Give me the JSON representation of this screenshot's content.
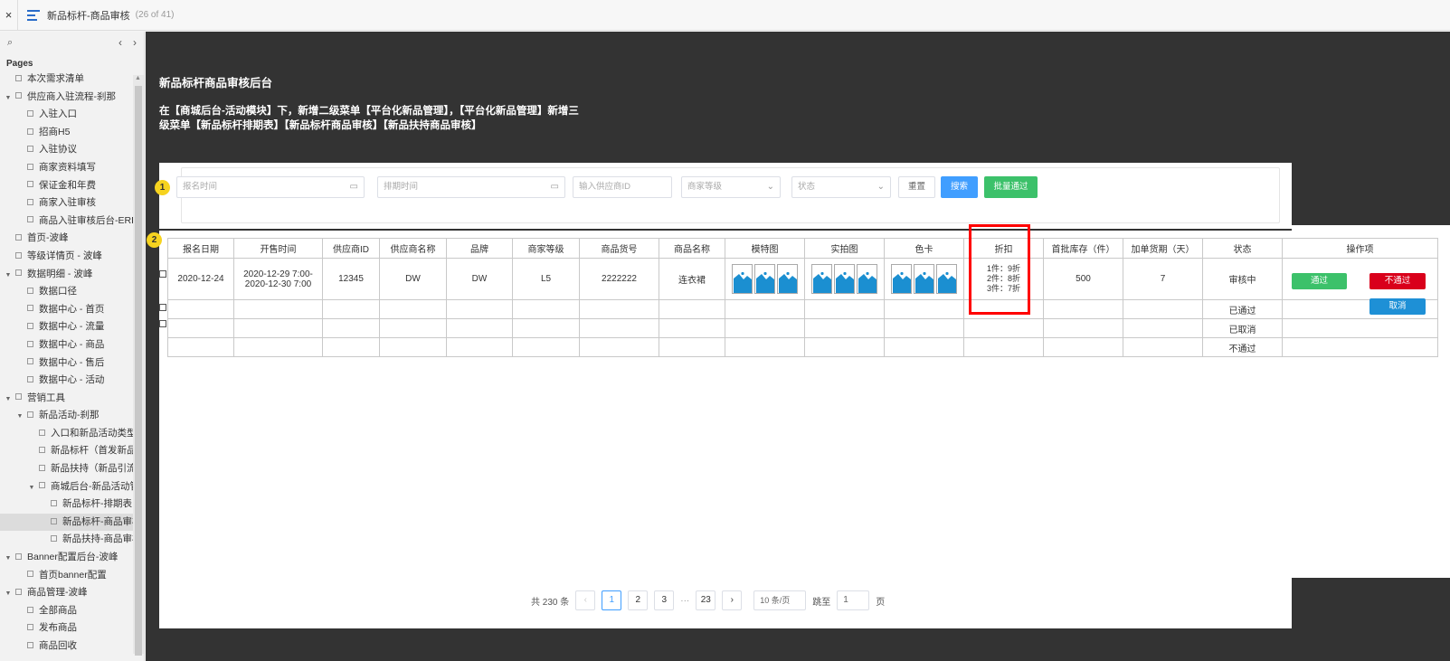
{
  "topbar": {
    "close": "×",
    "title": "新品标杆-商品审核",
    "count": "(26 of 41)"
  },
  "sidebar": {
    "search_icon": "⌕",
    "prev": "‹",
    "next": "›",
    "pages_label": "Pages",
    "items": [
      {
        "label": "本次需求清单",
        "level": 1,
        "toggle": ""
      },
      {
        "label": "供应商入驻流程-刹那",
        "level": 1,
        "toggle": "▼"
      },
      {
        "label": "入驻入口",
        "level": 2,
        "toggle": ""
      },
      {
        "label": "招商H5",
        "level": 2,
        "toggle": ""
      },
      {
        "label": "入驻协议",
        "level": 2,
        "toggle": ""
      },
      {
        "label": "商家资料填写",
        "level": 2,
        "toggle": ""
      },
      {
        "label": "保证金和年费",
        "level": 2,
        "toggle": ""
      },
      {
        "label": "商家入驻审核",
        "level": 2,
        "toggle": ""
      },
      {
        "label": "商品入驻审核后台-ERP",
        "level": 2,
        "toggle": ""
      },
      {
        "label": "首页-波峰",
        "level": 1,
        "toggle": ""
      },
      {
        "label": "等级详情页 - 波峰",
        "level": 1,
        "toggle": ""
      },
      {
        "label": "数据明细 - 波峰",
        "level": 1,
        "toggle": "▼"
      },
      {
        "label": "数据口径",
        "level": 2,
        "toggle": ""
      },
      {
        "label": "数据中心 - 首页",
        "level": 2,
        "toggle": ""
      },
      {
        "label": "数据中心 - 流量",
        "level": 2,
        "toggle": ""
      },
      {
        "label": "数据中心 - 商品",
        "level": 2,
        "toggle": ""
      },
      {
        "label": "数据中心 - 售后",
        "level": 2,
        "toggle": ""
      },
      {
        "label": "数据中心 - 活动",
        "level": 2,
        "toggle": ""
      },
      {
        "label": "营销工具",
        "level": 1,
        "toggle": "▼"
      },
      {
        "label": "新品活动-刹那",
        "level": 2,
        "toggle": "▼"
      },
      {
        "label": "入口和新品活动类型",
        "level": 3,
        "toggle": ""
      },
      {
        "label": "新品标杆（首发新品）",
        "level": 3,
        "toggle": ""
      },
      {
        "label": "新品扶持（新品引流）",
        "level": 3,
        "toggle": ""
      },
      {
        "label": "商城后台-新品活动管理",
        "level": 3,
        "toggle": "▼"
      },
      {
        "label": "新品标杆-排期表",
        "level": 4,
        "toggle": ""
      },
      {
        "label": "新品标杆-商品审核",
        "level": 4,
        "toggle": "",
        "selected": true
      },
      {
        "label": "新品扶持-商品审核",
        "level": 4,
        "toggle": ""
      },
      {
        "label": "Banner配置后台-波峰",
        "level": 1,
        "toggle": "▼"
      },
      {
        "label": "首页banner配置",
        "level": 2,
        "toggle": ""
      },
      {
        "label": "商品管理-波峰",
        "level": 1,
        "toggle": "▼"
      },
      {
        "label": "全部商品",
        "level": 2,
        "toggle": ""
      },
      {
        "label": "发布商品",
        "level": 2,
        "toggle": ""
      },
      {
        "label": "商品回收",
        "level": 2,
        "toggle": ""
      }
    ]
  },
  "page": {
    "heading": "新品标杆商品审核后台",
    "desc_line1": "在【商城后台-活动模块】下，新增二级菜单【平台化新品管理】，【平台化新品管理】新增三",
    "desc_line2": "级菜单【新品标杆排期表】【新品标杆商品审核】【新品扶持商品审核】"
  },
  "badges": {
    "one": "1",
    "two": "2"
  },
  "filters": {
    "signup_time": "报名时间",
    "schedule_time": "排期时间",
    "supplier_id": "输入供应商ID",
    "merchant_level": "商家等级",
    "status": "状态",
    "reset": "重置",
    "search": "搜索",
    "batch_pass": "批量通过"
  },
  "table": {
    "headers": [
      "报名日期",
      "开售时间",
      "供应商ID",
      "供应商名称",
      "品牌",
      "商家等级",
      "商品货号",
      "商品名称",
      "模特图",
      "实拍图",
      "色卡",
      "折扣",
      "首批库存（件）",
      "加单货期（天）",
      "状态",
      "操作项"
    ],
    "row1": {
      "date": "2020-12-24",
      "sale_start": "2020-12-29 7:00-",
      "sale_end": "2020-12-30 7:00",
      "supplier_id": "12345",
      "supplier_name": "DW",
      "brand": "DW",
      "level": "L5",
      "sku": "2222222",
      "name": "连衣裙",
      "discount1": "1件：9折",
      "discount2": "2件：8折",
      "discount3": "3件：7折",
      "stock": "500",
      "lead": "7",
      "status": "审核中"
    },
    "statuses": [
      "已通过",
      "已取消",
      "不通过"
    ],
    "actions": {
      "pass": "通过",
      "reject": "不通过",
      "cancel": "取消"
    }
  },
  "pager": {
    "total": "共 230 条",
    "prev": "‹",
    "pages": [
      "1",
      "2",
      "3"
    ],
    "ellipsis": "···",
    "last": "23",
    "next": "›",
    "size": "10 条/页",
    "jump_label": "跳至",
    "jump_value": "1",
    "page_suffix": "页"
  },
  "colors": {
    "canvas": "#333333",
    "primary": "#409eff",
    "success": "#3cc16a",
    "danger": "#d9001b",
    "highlight": "#ff0000",
    "badge": "#f6d31f"
  }
}
